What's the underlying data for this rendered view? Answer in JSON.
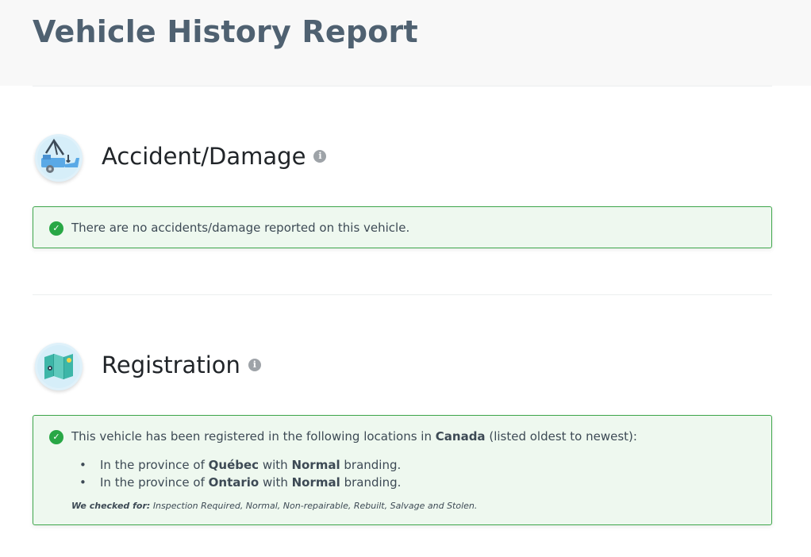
{
  "page": {
    "title": "Vehicle History Report"
  },
  "accident": {
    "icon": "tow-truck-icon",
    "title": "Accident/Damage",
    "info_icon": "info-icon",
    "message": "There are no accidents/damage reported on this vehicle.",
    "status_color": "#28a745"
  },
  "registration": {
    "icon": "map-icon",
    "title": "Registration",
    "info_icon": "info-icon",
    "intro_prefix": "This vehicle has been registered in the following locations in",
    "country": "Canada",
    "intro_suffix": "(listed oldest to newest):",
    "locations": [
      {
        "prefix": "In the province of",
        "province": "Québec",
        "mid": "with",
        "branding": "Normal",
        "suffix": "branding."
      },
      {
        "prefix": "In the province of",
        "province": "Ontario",
        "mid": "with",
        "branding": "Normal",
        "suffix": "branding."
      }
    ],
    "checked_label": "We checked for:",
    "checked_values": "Inspection Required, Normal, Non-repairable, Rebuilt, Salvage and Stolen."
  }
}
